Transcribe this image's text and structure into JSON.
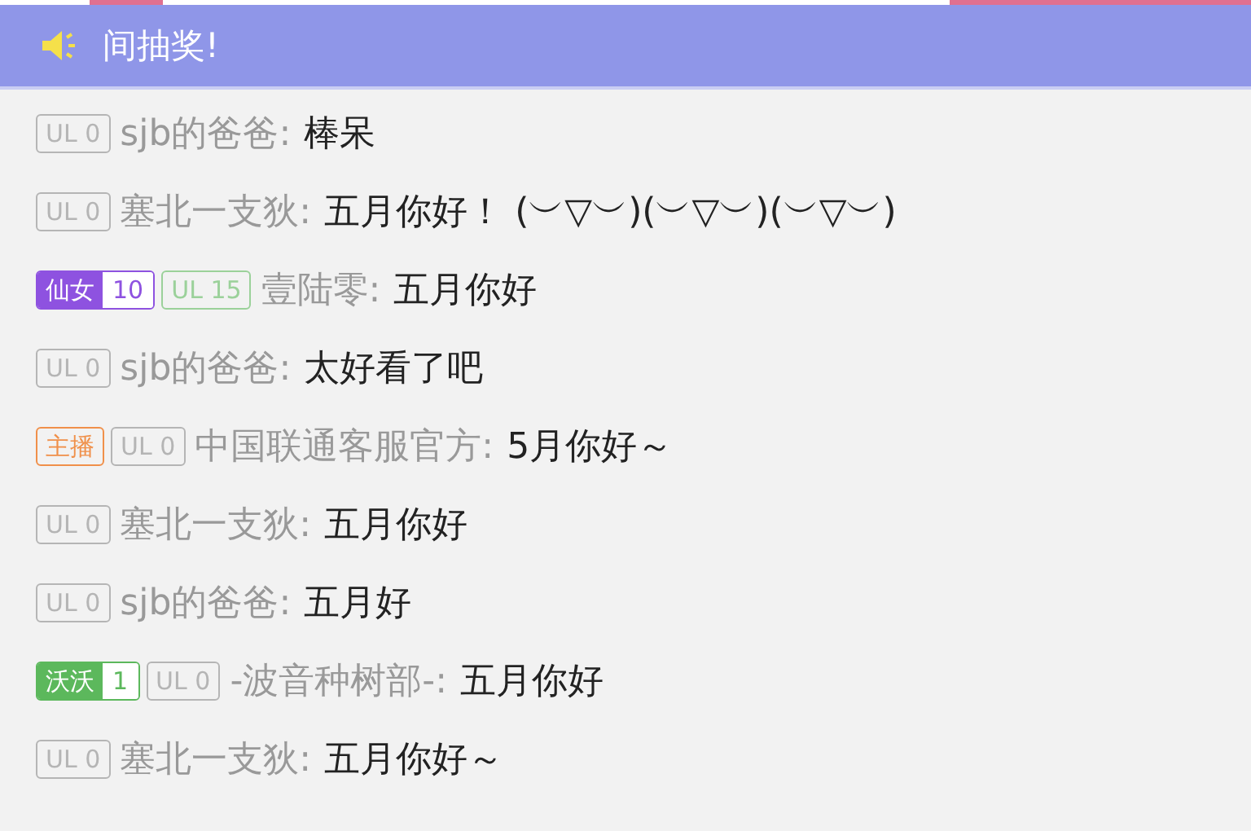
{
  "banner": {
    "text": "间抽奖!"
  },
  "messages": [
    {
      "badges": [
        {
          "kind": "level",
          "text": "UL 0",
          "color": "#b5b5b5"
        }
      ],
      "user": "sjb的爸爸:",
      "text": "棒呆"
    },
    {
      "badges": [
        {
          "kind": "level",
          "text": "UL 0",
          "color": "#b5b5b5"
        }
      ],
      "user": "塞北一支狄:",
      "text": "五月你好！ (︶▽︶)(︶▽︶)(︶▽︶)"
    },
    {
      "badges": [
        {
          "kind": "medal",
          "text": "仙女",
          "level": "10",
          "color": "#8e52e0"
        },
        {
          "kind": "level",
          "text": "UL 15",
          "color": "#9bd19a"
        }
      ],
      "user": "壹陆零:",
      "text": "五月你好"
    },
    {
      "badges": [
        {
          "kind": "level",
          "text": "UL 0",
          "color": "#b5b5b5"
        }
      ],
      "user": "sjb的爸爸:",
      "text": "太好看了吧"
    },
    {
      "badges": [
        {
          "kind": "anchor",
          "text": "主播",
          "color": "#f0904a"
        },
        {
          "kind": "level",
          "text": "UL 0",
          "color": "#b5b5b5"
        }
      ],
      "user": "中国联通客服官方:",
      "text": "5月你好～"
    },
    {
      "badges": [
        {
          "kind": "level",
          "text": "UL 0",
          "color": "#b5b5b5"
        }
      ],
      "user": "塞北一支狄:",
      "text": "五月你好"
    },
    {
      "badges": [
        {
          "kind": "level",
          "text": "UL 0",
          "color": "#b5b5b5"
        }
      ],
      "user": "sjb的爸爸:",
      "text": "五月好"
    },
    {
      "badges": [
        {
          "kind": "medal",
          "text": "沃沃",
          "level": "1",
          "color": "#5cb85c"
        },
        {
          "kind": "level",
          "text": "UL 0",
          "color": "#b5b5b5"
        }
      ],
      "user": "-波音种树部-:",
      "text": "五月你好"
    },
    {
      "badges": [
        {
          "kind": "level",
          "text": "UL 0",
          "color": "#b5b5b5"
        }
      ],
      "user": "塞北一支狄:",
      "text": "五月你好～"
    }
  ]
}
